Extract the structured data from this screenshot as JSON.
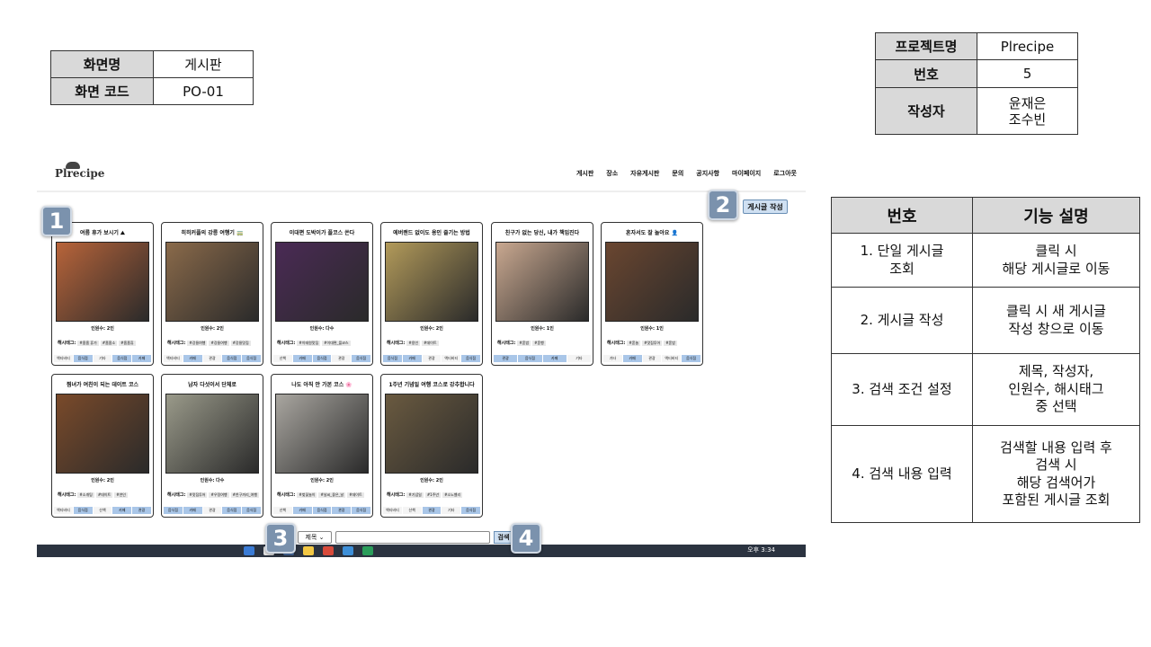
{
  "screen_info": {
    "name_label": "화면명",
    "name_value": "게시판",
    "code_label": "화면 코드",
    "code_value": "PO-01"
  },
  "project_info": {
    "project_label": "프로젝트명",
    "project_value": "Plrecipe",
    "number_label": "번호",
    "number_value": "5",
    "author_label": "작성자",
    "author_line1": "윤재은",
    "author_line2": "조수빈"
  },
  "functions": {
    "col_number": "번호",
    "col_desc": "기능 설명",
    "rows": [
      {
        "name_l1": "1. 단일 게시글",
        "name_l2": "조회",
        "desc_l1": "클릭 시",
        "desc_l2": "해당 게시글로 이동",
        "desc_l3": "",
        "desc_l4": ""
      },
      {
        "name_l1": "2. 게시글 작성",
        "name_l2": "",
        "desc_l1": "클릭 시 새 게시글",
        "desc_l2": "작성 창으로 이동",
        "desc_l3": "",
        "desc_l4": ""
      },
      {
        "name_l1": "3. 검색 조건 설정",
        "name_l2": "",
        "desc_l1": "제목, 작성자,",
        "desc_l2": "인원수, 해시태그",
        "desc_l3": "중 선택",
        "desc_l4": ""
      },
      {
        "name_l1": "4. 검색 내용 입력",
        "name_l2": "",
        "desc_l1": "검색할 내용 입력 후",
        "desc_l2": "검색 시",
        "desc_l3": "해당 검색어가",
        "desc_l4": "포함된 게시글 조회"
      }
    ]
  },
  "app": {
    "logo": "Plrecipe",
    "nav": [
      "게시판",
      "장소",
      "자유게시판",
      "문의",
      "공지사항",
      "마이페이지",
      "로그아웃"
    ],
    "write_button": "게시글 작성",
    "search": {
      "select_value": "제목 ⌄",
      "button": "검색",
      "input_value": ""
    },
    "clock": "오후 3:34"
  },
  "markers": [
    "1",
    "2",
    "3",
    "4"
  ],
  "cards": [
    {
      "title": "여름 휴가 보시기 ⛰",
      "people": "인원수: 2인",
      "hashtag_label": "해시태그:",
      "tags": [
        "#흠흠 휴가",
        "#흠흠소",
        "#흠흠휴"
      ],
      "cats": [
        "액티비티",
        "음식점",
        "기타",
        "음식점",
        "카페"
      ],
      "on": [
        false,
        true,
        false,
        true,
        true
      ],
      "photo": "#b8643a"
    },
    {
      "title": "히히커플의 강릉 여행기 🚃",
      "people": "인원수: 2인",
      "hashtag_label": "해시태그:",
      "tags": [
        "#강릉여행",
        "#강릉여행",
        "#강릉맛집"
      ],
      "cats": [
        "액티비티",
        "카페",
        "관광",
        "음식점",
        "음식점"
      ],
      "on": [
        false,
        true,
        false,
        true,
        true
      ],
      "photo": "#8a6a4a"
    },
    {
      "title": "이대편 도박이가 플코스 쏜다",
      "people": "인원수: 다수",
      "hashtag_label": "해시태그:",
      "tags": [
        "#이태원맛집",
        "#이대편_플코스"
      ],
      "cats": [
        "산책",
        "카페",
        "음식점",
        "관광",
        "음식점"
      ],
      "on": [
        false,
        true,
        true,
        false,
        true
      ],
      "photo": "#4a2a55"
    },
    {
      "title": "에버랜드 없이도 용인 즐기는 방법",
      "people": "인원수: 2인",
      "hashtag_label": "해시태그:",
      "tags": [
        "#용인",
        "#데이트"
      ],
      "cats": [
        "음식점",
        "카페",
        "관광",
        "액티비티",
        "음식점"
      ],
      "on": [
        true,
        true,
        false,
        false,
        true
      ],
      "photo": "#b29a5a"
    },
    {
      "title": "친구가 없는 당신, 내가 책임진다",
      "people": "인원수: 1인",
      "hashtag_label": "해시태그:",
      "tags": [
        "#혼밥",
        "#혼행"
      ],
      "cats": [
        "관광",
        "음식점",
        "카페",
        "기타"
      ],
      "on": [
        true,
        true,
        true,
        false
      ],
      "photo": "#c9a890"
    },
    {
      "title": "혼자서도 잘 놀아요 👤",
      "people": "인원수: 1인",
      "hashtag_label": "해시태그:",
      "tags": [
        "#혼놀",
        "#맛집투어",
        "#혼밥"
      ],
      "cats": [
        "기타",
        "카페",
        "관광",
        "액티비티",
        "음식점"
      ],
      "on": [
        false,
        true,
        false,
        false,
        true
      ],
      "photo": "#6a4630"
    },
    {
      "title": "찜녀가 여친이 되는 데이트 코스",
      "people": "인원수: 2인",
      "hashtag_label": "해시태그:",
      "tags": [
        "#소개팅",
        "#데이트",
        "#연인"
      ],
      "cats": [
        "액티비티",
        "음식점",
        "산책",
        "카페",
        "관광"
      ],
      "on": [
        false,
        true,
        false,
        true,
        true
      ],
      "photo": "#7a4a2a"
    },
    {
      "title": "남자 다섯이서 단체로",
      "people": "인원수: 다수",
      "hashtag_label": "해시태그:",
      "tags": [
        "#맛집투어",
        "#우정여행",
        "#친구끼리_여행"
      ],
      "cats": [
        "음식점",
        "카페",
        "관광",
        "음식점",
        "음식점"
      ],
      "on": [
        true,
        true,
        false,
        true,
        true
      ],
      "photo": "#9a9a8a"
    },
    {
      "title": "나도 아직 안 가본 코스 🌸",
      "people": "인원수: 2인",
      "hashtag_label": "해시태그:",
      "tags": [
        "#벚꽃놀이",
        "#날씨_좋은_날",
        "#데이트"
      ],
      "cats": [
        "산책",
        "카페",
        "음식점",
        "관광",
        "음식점"
      ],
      "on": [
        false,
        true,
        true,
        true,
        true
      ],
      "photo": "#a9a6a0"
    },
    {
      "title": "1주년 기념일 여행 코스로 강추합니다",
      "people": "인원수: 2인",
      "hashtag_label": "해시태그:",
      "tags": [
        "#기념일",
        "#1주년",
        "#소노벨리"
      ],
      "cats": [
        "액티비티",
        "산책",
        "관광",
        "기타",
        "음식점"
      ],
      "on": [
        false,
        false,
        true,
        false,
        true
      ],
      "photo": "#6a5a40"
    }
  ]
}
